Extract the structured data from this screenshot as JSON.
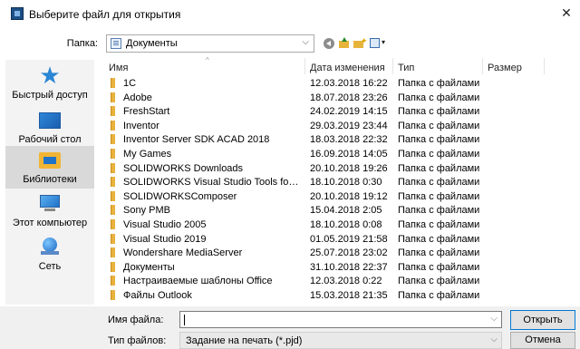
{
  "window": {
    "title": "Выберите файл для открытия",
    "close_glyph": "✕"
  },
  "location": {
    "label": "Папка:",
    "value": "Документы",
    "arrow": "⌵"
  },
  "toolbar": {
    "icons": [
      "back-icon",
      "up-folder-icon",
      "new-folder-icon",
      "view-menu-icon"
    ],
    "view_dropdown": "▾"
  },
  "places": [
    {
      "label": "Быстрый доступ",
      "icon": "star-icon"
    },
    {
      "label": "Рабочий стол",
      "icon": "desktop-icon"
    },
    {
      "label": "Библиотеки",
      "icon": "libraries-icon",
      "selected": true
    },
    {
      "label": "Этот компьютер",
      "icon": "computer-icon"
    },
    {
      "label": "Сеть",
      "icon": "network-icon"
    }
  ],
  "list": {
    "columns": {
      "name": "Имя",
      "date": "Дата изменения",
      "type": "Тип",
      "size": "Размер"
    },
    "sort_glyph": "^",
    "rows": [
      {
        "name": "1C",
        "date": "12.03.2018 16:22",
        "type": "Папка с файлами"
      },
      {
        "name": "Adobe",
        "date": "18.07.2018 23:26",
        "type": "Папка с файлами"
      },
      {
        "name": "FreshStart",
        "date": "24.02.2019 14:15",
        "type": "Папка с файлами"
      },
      {
        "name": "Inventor",
        "date": "29.03.2019 23:44",
        "type": "Папка с файлами"
      },
      {
        "name": "Inventor Server SDK ACAD 2018",
        "date": "18.03.2018 22:32",
        "type": "Папка с файлами"
      },
      {
        "name": "My Games",
        "date": "16.09.2018 14:05",
        "type": "Папка с файлами"
      },
      {
        "name": "SOLIDWORKS Downloads",
        "date": "20.10.2018 19:26",
        "type": "Папка с файлами"
      },
      {
        "name": "SOLIDWORKS Visual Studio Tools for Applic...",
        "date": "18.10.2018 0:30",
        "type": "Папка с файлами"
      },
      {
        "name": "SOLIDWORKSComposer",
        "date": "20.10.2018 19:12",
        "type": "Папка с файлами"
      },
      {
        "name": "Sony PMB",
        "date": "15.04.2018 2:05",
        "type": "Папка с файлами"
      },
      {
        "name": "Visual Studio 2005",
        "date": "18.10.2018 0:08",
        "type": "Папка с файлами"
      },
      {
        "name": "Visual Studio 2019",
        "date": "01.05.2019 21:58",
        "type": "Папка с файлами"
      },
      {
        "name": "Wondershare MediaServer",
        "date": "25.07.2018 23:02",
        "type": "Папка с файлами"
      },
      {
        "name": "Документы",
        "date": "31.10.2018 22:37",
        "type": "Папка с файлами"
      },
      {
        "name": "Настраиваемые шаблоны Office",
        "date": "12.03.2018 0:22",
        "type": "Папка с файлами"
      },
      {
        "name": "Файлы Outlook",
        "date": "15.03.2018 21:35",
        "type": "Папка с файлами"
      }
    ]
  },
  "footer": {
    "filename_label": "Имя файла:",
    "filename_value": "",
    "filetype_label": "Тип файлов:",
    "filetype_value": "Задание на печать (*.pjd)",
    "arrow": "⌵",
    "open_label": "Открыть",
    "cancel_label": "Отмена"
  }
}
